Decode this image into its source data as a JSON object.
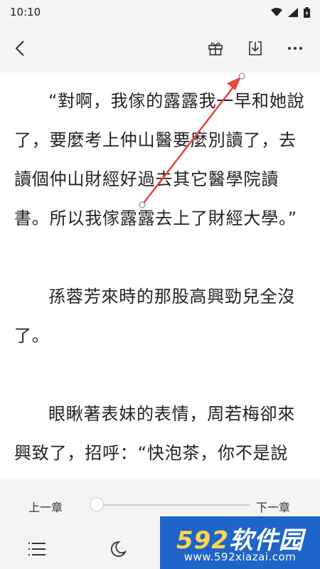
{
  "status_bar": {
    "time": "10:10",
    "icons": [
      "wifi-icon",
      "signal-icon",
      "battery-icon"
    ]
  },
  "toolbar": {
    "icons": [
      "back-icon",
      "gift-icon",
      "download-icon",
      "more-icon"
    ]
  },
  "content": {
    "paragraphs": [
      "“對啊，我傢的露露我一早和她說了，要麼考上仲山醫要麼別讀了，去讀個仲山財經好過去其它醫學院讀書。所以我傢露露去上了財經大學。”",
      "孫蓉芳來時的那股高興勁兒全沒了。",
      "眼瞅著表妹的表情，周若梅卻來興致了，招呼：“快泡茶，你不是說你"
    ]
  },
  "bottom": {
    "prev_chapter": "上一章",
    "next_chapter": "下一章",
    "progress": 0.0,
    "icons": [
      "menu-list-icon",
      "night-mode-icon"
    ]
  },
  "watermark": {
    "brand_num": "592",
    "brand_text": "软件园",
    "url": "www.592xiazai.com"
  },
  "colors": {
    "annotation_arrow": "#e8473f",
    "watermark_bg": "#1f64c8"
  }
}
